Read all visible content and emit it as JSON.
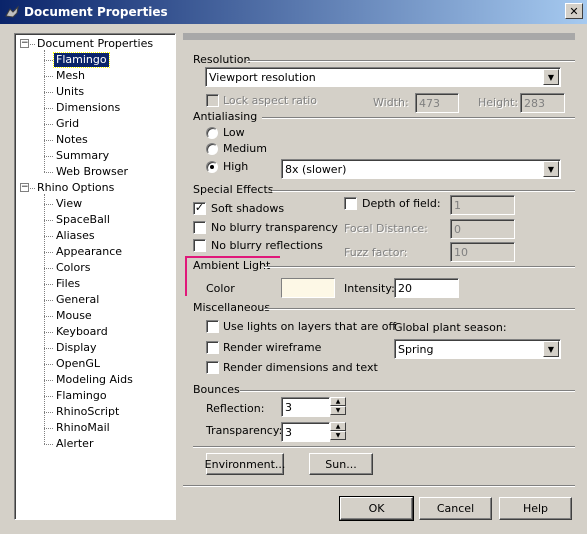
{
  "window": {
    "title": "Document Properties",
    "close": "✕"
  },
  "tree": {
    "items": [
      {
        "label": "Document Properties",
        "level": 0,
        "expanded": true
      },
      {
        "label": "Flamingo",
        "level": 1,
        "selected": true
      },
      {
        "label": "Mesh",
        "level": 1
      },
      {
        "label": "Units",
        "level": 1
      },
      {
        "label": "Dimensions",
        "level": 1
      },
      {
        "label": "Grid",
        "level": 1
      },
      {
        "label": "Notes",
        "level": 1
      },
      {
        "label": "Summary",
        "level": 1
      },
      {
        "label": "Web Browser",
        "level": 1
      },
      {
        "label": "Rhino Options",
        "level": 0,
        "expanded": true
      },
      {
        "label": "View",
        "level": 1
      },
      {
        "label": "SpaceBall",
        "level": 1
      },
      {
        "label": "Aliases",
        "level": 1
      },
      {
        "label": "Appearance",
        "level": 1
      },
      {
        "label": "Colors",
        "level": 1
      },
      {
        "label": "Files",
        "level": 1
      },
      {
        "label": "General",
        "level": 1
      },
      {
        "label": "Mouse",
        "level": 1
      },
      {
        "label": "Keyboard",
        "level": 1
      },
      {
        "label": "Display",
        "level": 1
      },
      {
        "label": "OpenGL",
        "level": 1
      },
      {
        "label": "Modeling Aids",
        "level": 1
      },
      {
        "label": "Flamingo",
        "level": 1
      },
      {
        "label": "RhinoScript",
        "level": 1
      },
      {
        "label": "RhinoMail",
        "level": 1
      },
      {
        "label": "Alerter",
        "level": 1
      }
    ]
  },
  "resolution": {
    "label": "Resolution",
    "selected": "Viewport resolution",
    "lock_aspect": "Lock aspect ratio",
    "width_label": "Width:",
    "width_value": "473",
    "height_label": "Height:",
    "height_value": "283"
  },
  "antialiasing": {
    "label": "Antialiasing",
    "low": "Low",
    "medium": "Medium",
    "high": "High",
    "selected": "high",
    "quality_selected": "8x (slower)"
  },
  "special_effects": {
    "label": "Special Effects",
    "soft_shadows": "Soft shadows",
    "soft_shadows_checked": true,
    "no_blurry_transparency": "No blurry transparency",
    "no_blurry_reflections": "No blurry reflections",
    "depth_of_field": "Depth of field:",
    "depth_of_field_value": "1",
    "focal_distance": "Focal Distance:",
    "focal_distance_value": "0",
    "fuzz_factor": "Fuzz factor:",
    "fuzz_factor_value": "10"
  },
  "ambient_light": {
    "label": "Ambient Light",
    "color_label": "Color",
    "color": "#fdf8e6",
    "intensity_label": "Intensity:",
    "intensity_value": "20",
    "highlight_color": "#e0187a"
  },
  "misc": {
    "label": "Miscellaneous",
    "use_lights": "Use lights on layers that are off",
    "render_wireframe": "Render wireframe",
    "render_dimensions": "Render dimensions and text",
    "plant_season_label": "Global plant season:",
    "plant_season_value": "Spring"
  },
  "bounces": {
    "label": "Bounces",
    "reflection_label": "Reflection:",
    "reflection_value": "3",
    "transparency_label": "Transparency:",
    "transparency_value": "3"
  },
  "buttons": {
    "environment": "Environment...",
    "sun": "Sun...",
    "ok": "OK",
    "cancel": "Cancel",
    "help": "Help"
  },
  "icons": {
    "title": "rhino-app-icon",
    "close": "close-icon",
    "dropdown": "chevron-down-icon",
    "check": "checkmark-icon"
  },
  "glyphs": {
    "down": "▼",
    "up": "▲",
    "check": "✓",
    "minus": "−"
  }
}
